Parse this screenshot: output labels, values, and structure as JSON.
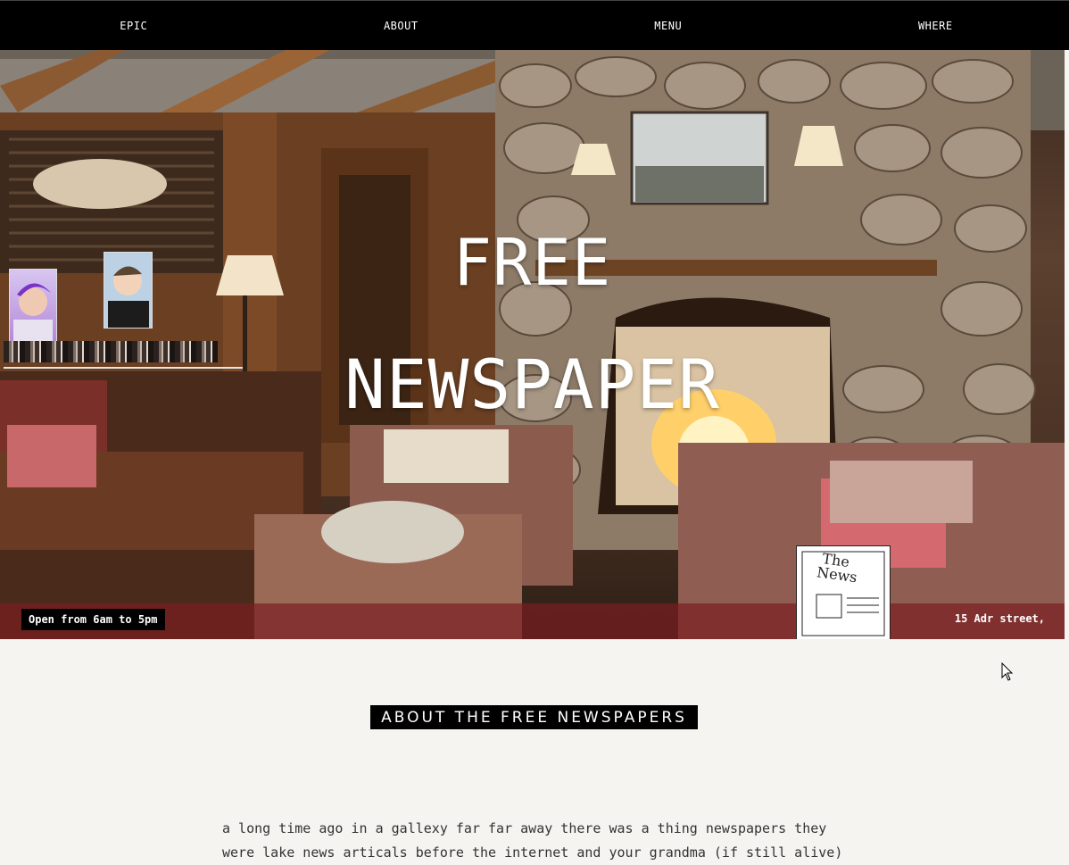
{
  "nav": {
    "items": [
      {
        "label": "EPIC"
      },
      {
        "label": "ABOUT"
      },
      {
        "label": "MENU"
      },
      {
        "label": "WHERE"
      }
    ]
  },
  "hero": {
    "title_line1": "FREE",
    "title_line2": "NEWSPAPER",
    "hours": "Open from 6am to 5pm",
    "address": "15 Adr street,",
    "sketch_text": "The News"
  },
  "about": {
    "heading": "ABOUT THE FREE NEWSPAPERS",
    "body": "a long time ago in a gallexy far far away there was a thing newspapers they were lake news articals before the internet and your grandma (if still alive)"
  },
  "colors": {
    "nav_bg": "#000000",
    "page_bg": "#f5f4f1",
    "text": "#333333"
  }
}
